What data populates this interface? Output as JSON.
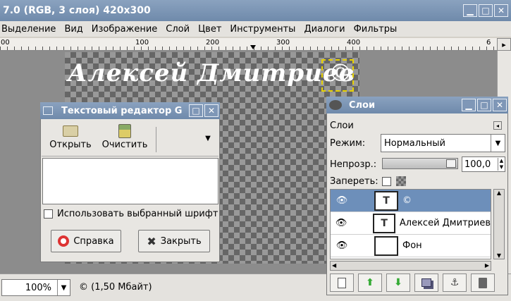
{
  "main": {
    "title": "7.0 (RGB, 3 слоя) 420x300",
    "menu": [
      "Выделение",
      "Вид",
      "Изображение",
      "Слой",
      "Цвет",
      "Инструменты",
      "Диалоги",
      "Фильтры"
    ],
    "ruler_ticks": [
      "00",
      "100",
      "200",
      "300",
      "400",
      "6"
    ],
    "canvas_text": "Алексей Дмитриев",
    "copyright_text": "©",
    "zoom": "100%",
    "status": "© (1,50 Мбайт)"
  },
  "text_editor": {
    "title": "Текстовый редактор G",
    "open_label": "Открыть",
    "clear_label": "Очистить",
    "use_font_label": "Использовать выбранный шрифт",
    "help_label": "Справка",
    "close_label": "Закрыть"
  },
  "layers": {
    "title": "Слои",
    "tab_label": "Слои",
    "mode_label": "Режим:",
    "mode_value": "Нормальный",
    "opacity_label": "Непрозр.:",
    "opacity_value": "100,0",
    "lock_label": "Запереть:",
    "items": [
      {
        "name": "©",
        "selected": true
      },
      {
        "name": "Алексей Дмитриев",
        "selected": false
      },
      {
        "name": "Фон",
        "selected": false
      }
    ]
  }
}
